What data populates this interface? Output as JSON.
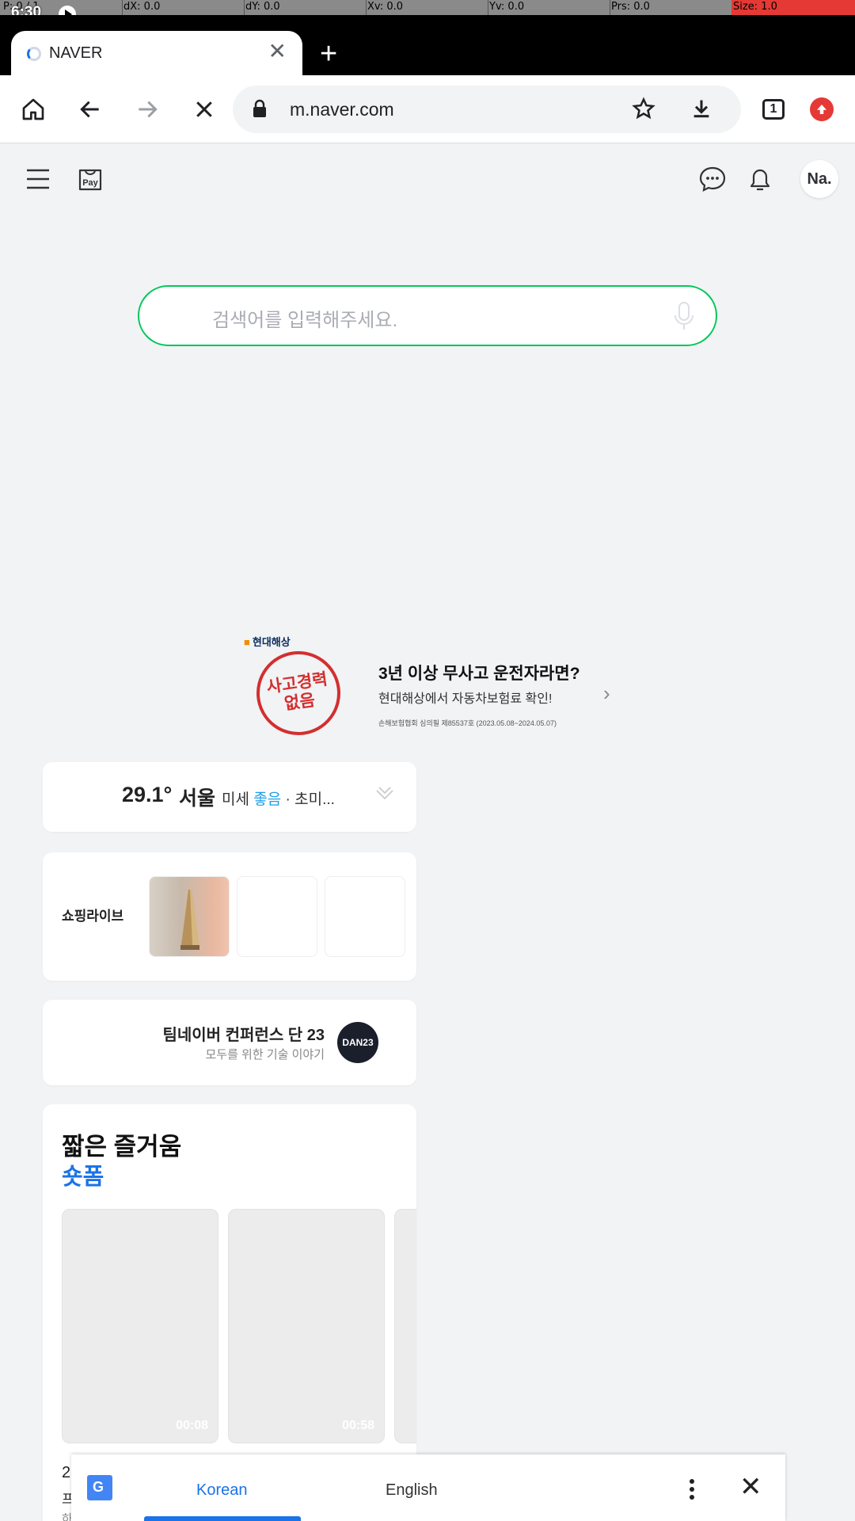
{
  "debug_bar": {
    "p": "P: 0 / 1",
    "dx": "dX: 0.0",
    "dy": "dY: 0.0",
    "xv": "Xv: 0.0",
    "yv": "Yv: 0.0",
    "prs": "Prs: 0.0",
    "size": "Size: 1.0"
  },
  "status": {
    "time": "6:30"
  },
  "tab": {
    "title": "NAVER",
    "close": "✕",
    "new_tab": "+"
  },
  "toolbar": {
    "url": "m.naver.com",
    "tab_count": "1"
  },
  "header": {
    "avatar": "Na."
  },
  "search": {
    "placeholder": "검색어를 입력해주세요."
  },
  "ad": {
    "brand": "현대해상",
    "stamp": "사고경력\n없음",
    "headline": "3년 이상 무사고 운전자라면?",
    "sub": "현대해상에서 자동차보험료 확인!",
    "fine": "손해보험협회 심의필 제85537호 (2023.05.08~2024.05.07)"
  },
  "weather": {
    "temp": "29.1°",
    "city": "서울",
    "dust_prefix": "미세",
    "dust_status": "좋음",
    "dust_suffix": "· 초미..."
  },
  "shopping": {
    "label": "쇼핑라이브"
  },
  "conference": {
    "title": "팀네이버 컨퍼런스 단 23",
    "subtitle": "모두를 위한 기술 이야기",
    "logo": "DAN23"
  },
  "shorts": {
    "heading": "짧은 즐거움",
    "subheading": "숏폼",
    "videos": [
      {
        "duration": "00:08"
      },
      {
        "duration": "00:58"
      }
    ],
    "peek_lines": [
      "2",
      "프",
      "하"
    ]
  },
  "translate": {
    "source_lang": "Korean",
    "target_lang": "English"
  },
  "colors": {
    "naver_green": "#03c75a",
    "accent_blue": "#1a73e8",
    "good_blue": "#1a9ee8",
    "ad_red": "#d32f2f"
  }
}
